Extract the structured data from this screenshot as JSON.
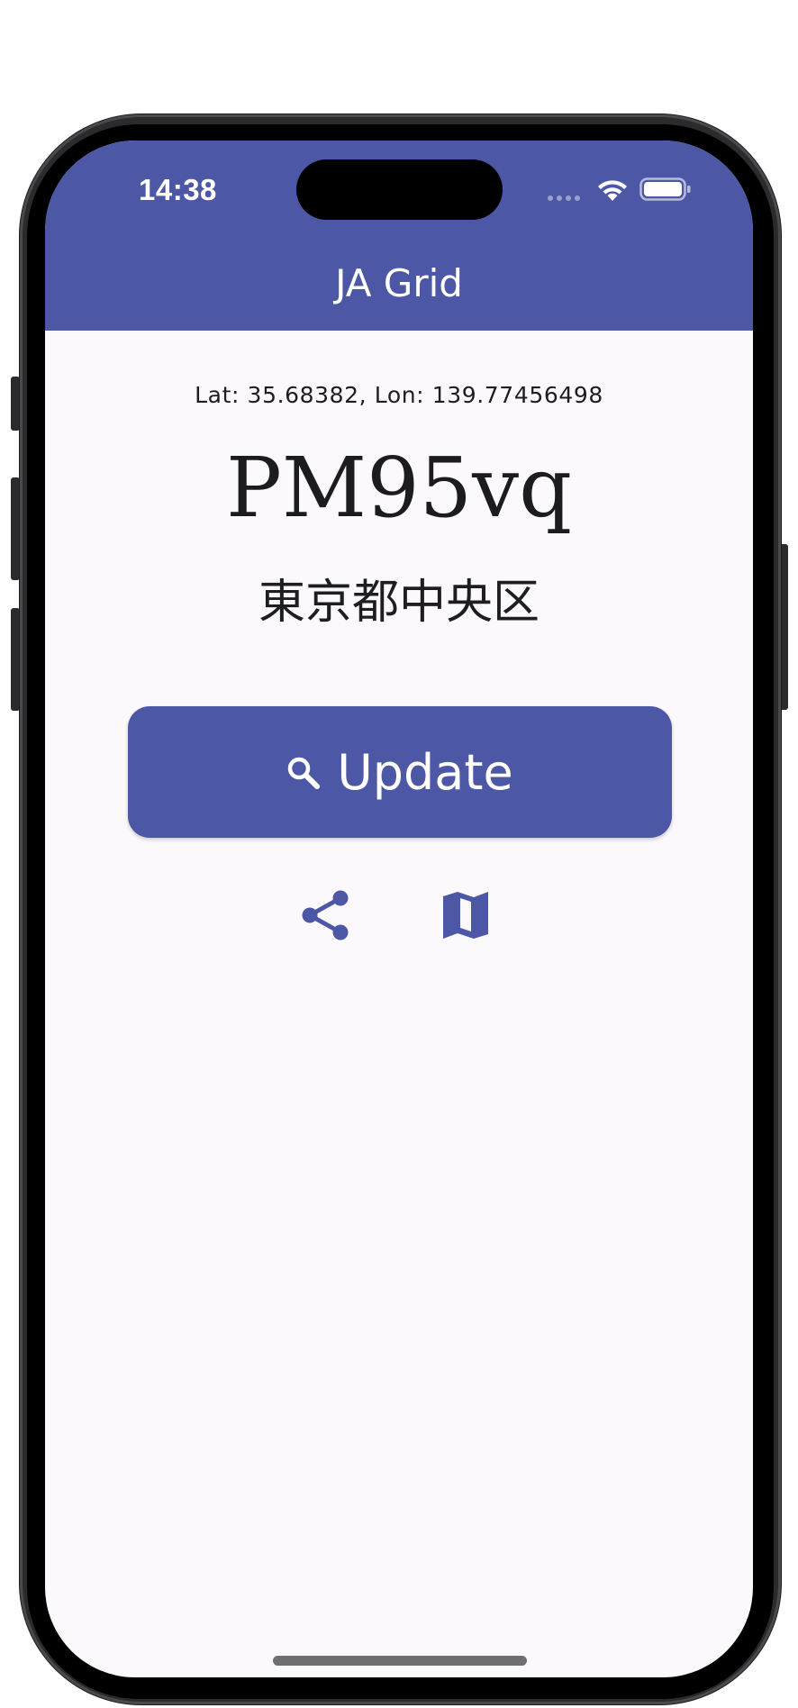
{
  "status_bar": {
    "time": "14:38",
    "wifi_icon": "wifi-icon",
    "battery_icon": "battery-full-icon"
  },
  "app_bar": {
    "title": "JA Grid",
    "color": "#4c57a6"
  },
  "location": {
    "coordinates_text": "Lat: 35.68382, Lon: 139.77456498",
    "grid_locator": "PM95vq",
    "place_name": "東京都中央区"
  },
  "actions": {
    "update_label": "Update",
    "update_icon": "search-icon",
    "share_icon": "share-icon",
    "map_icon": "map-icon"
  },
  "colors": {
    "primary": "#4c57a6",
    "background": "#fcf9fc",
    "text": "#1c1c1f"
  }
}
